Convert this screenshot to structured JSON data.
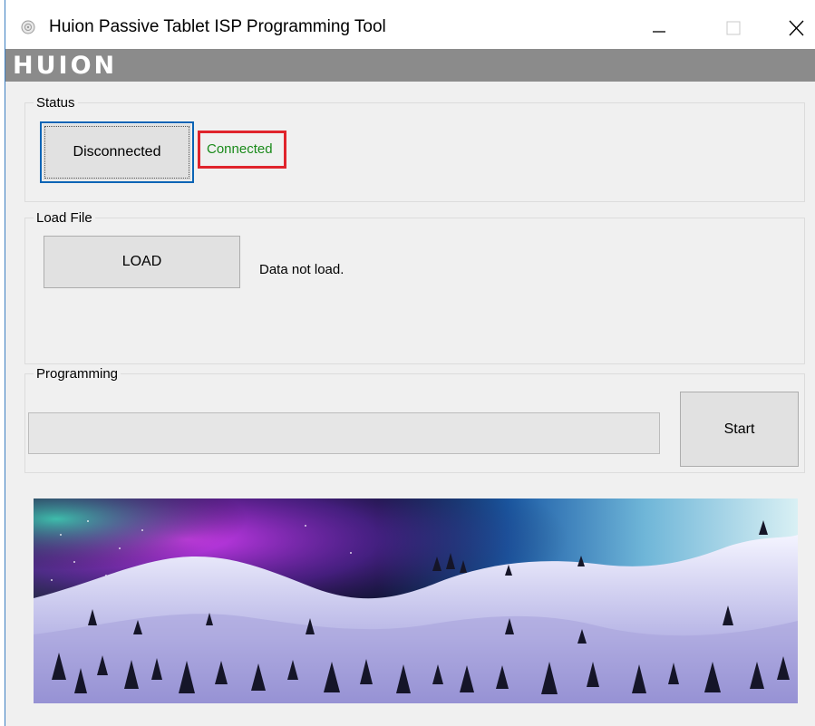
{
  "window": {
    "title": "Huion Passive Tablet ISP Programming Tool",
    "controls": {
      "minimize_icon": "minimize-icon",
      "maximize_icon": "maximize-icon",
      "close_icon": "close-icon"
    }
  },
  "brand": {
    "logo": "HUION"
  },
  "status_group": {
    "title": "Status",
    "connect_button_label": "Disconnected",
    "connection_text": "Connected",
    "connection_color": "#1a8a1a",
    "annotation_color": "#e0242c"
  },
  "load_group": {
    "title": "Load File",
    "load_button_label": "LOAD",
    "message": "Data not load."
  },
  "programming_group": {
    "title": "Programming",
    "progress": 0,
    "start_button_label": "Start"
  },
  "banner_image": {
    "icon": "mountain-scenery-image"
  }
}
